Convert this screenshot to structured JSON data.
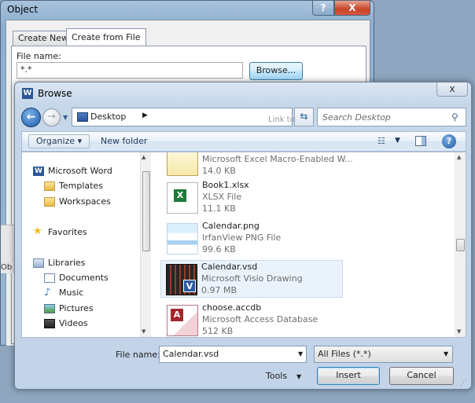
{
  "object_dialog": {
    "title": "Object",
    "help_button": "?",
    "close_button": "X",
    "tabs": [
      {
        "label": "Create New"
      },
      {
        "label": "Create from File"
      }
    ],
    "file_name_label": "File name:",
    "file_name_value": "*.*",
    "browse_button": "Browse...",
    "partial_label": "Ob"
  },
  "browse_dialog": {
    "title": "Browse",
    "close_button": "x",
    "address": "Desktop",
    "link_to_file_fragment": "Link to file",
    "search_placeholder": "Search Desktop",
    "toolbar": {
      "organize": "Organize",
      "new_folder": "New folder",
      "help": "?"
    },
    "nav_pane": [
      {
        "label": "Microsoft Word",
        "icon": "word-icon"
      },
      {
        "label": "Templates",
        "icon": "folder-icon"
      },
      {
        "label": "Workspaces",
        "icon": "folder-icon"
      },
      {
        "label": "Favorites",
        "icon": "star-icon"
      },
      {
        "label": "Libraries",
        "icon": "libraries-icon"
      },
      {
        "label": "Documents",
        "icon": "documents-icon"
      },
      {
        "label": "Music",
        "icon": "music-icon"
      },
      {
        "label": "Pictures",
        "icon": "pictures-icon"
      },
      {
        "label": "Videos",
        "icon": "videos-icon"
      }
    ],
    "files": [
      {
        "name": "",
        "type": "Microsoft Excel Macro-Enabled W...",
        "size": "14.0 KB",
        "thumb": "xlsm"
      },
      {
        "name": "Book1.xlsx",
        "type": "XLSX File",
        "size": "11.1 KB",
        "thumb": "xlsx"
      },
      {
        "name": "Calendar.png",
        "type": "IrfanView PNG File",
        "size": "99.6 KB",
        "thumb": "png"
      },
      {
        "name": "Calendar.vsd",
        "type": "Microsoft Visio Drawing",
        "size": "0.97 MB",
        "thumb": "vsd",
        "selected": true
      },
      {
        "name": "choose.accdb",
        "type": "Microsoft Access Database",
        "size": "512 KB",
        "thumb": "accdb"
      }
    ],
    "file_name_label": "File name:",
    "file_name_value": "Calendar.vsd",
    "file_type_filter": "All Files (*.*)",
    "tools": "Tools",
    "insert_button": "Insert",
    "cancel_button": "Cancel"
  }
}
